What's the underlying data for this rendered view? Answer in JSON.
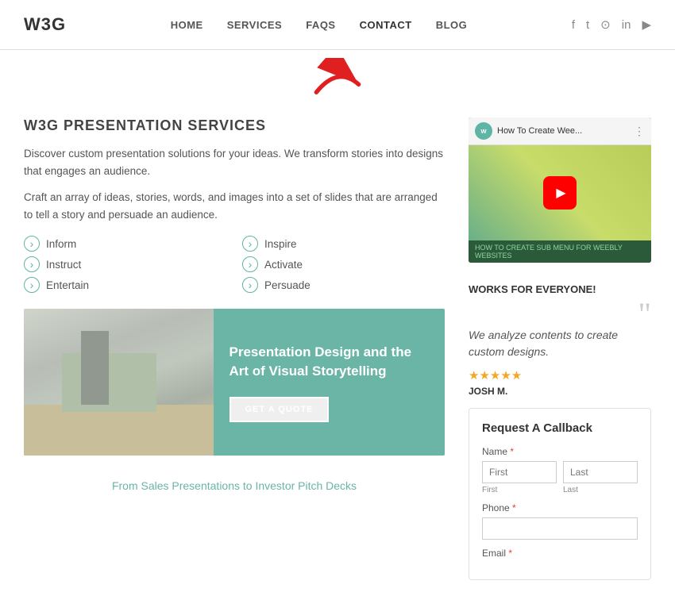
{
  "header": {
    "logo": "W3G",
    "nav": [
      {
        "label": "HOME",
        "href": "#",
        "active": false
      },
      {
        "label": "SERVICES",
        "href": "#",
        "active": false
      },
      {
        "label": "FAQS",
        "href": "#",
        "active": false
      },
      {
        "label": "CONTACT",
        "href": "#",
        "active": true
      },
      {
        "label": "BLOG",
        "href": "#",
        "active": false
      }
    ],
    "social": [
      {
        "name": "facebook",
        "icon": "f"
      },
      {
        "name": "twitter",
        "icon": "t"
      },
      {
        "name": "instagram",
        "icon": "📷"
      },
      {
        "name": "linkedin",
        "icon": "in"
      },
      {
        "name": "youtube",
        "icon": "▶"
      }
    ]
  },
  "main": {
    "section_title": "W3G PRESENTATION SERVICES",
    "desc1": "Discover custom presentation solutions for your ideas. We transform stories into designs that engages an audience.",
    "desc2": "Craft an array of ideas, stories, words, and images into a set of slides that are arranged to tell a story and persuade an audience.",
    "features": [
      {
        "label": "Inform"
      },
      {
        "label": "Inspire"
      },
      {
        "label": "Instruct"
      },
      {
        "label": "Activate"
      },
      {
        "label": "Entertain"
      },
      {
        "label": "Persuade"
      }
    ],
    "banner": {
      "heading": "Presentation Design and the Art of Visual Storytelling",
      "button": "GET A QUOTE"
    },
    "bottom_text": "From Sales Presentations to Investor Pitch Decks"
  },
  "sidebar": {
    "video": {
      "title": "How To Create Wee...",
      "avatar_text": "w",
      "bottom_text": "HOW TO CREATE SUB MENU FOR WEEBLY WEBSITES"
    },
    "testimonial": {
      "section_title": "WORKS FOR EVERYONE!",
      "quote": "We analyze contents to create custom designs.",
      "stars": "★★★★★",
      "author": "JOSH M."
    },
    "callback": {
      "title": "Request A Callback",
      "name_label": "Name",
      "first_placeholder": "First",
      "last_placeholder": "Last",
      "first_sublabel": "First",
      "last_sublabel": "Last",
      "phone_label": "Phone",
      "phone_placeholder": "",
      "email_label": "Email"
    }
  },
  "colors": {
    "teal": "#6ab5a5",
    "accent": "#5fb5a5"
  }
}
